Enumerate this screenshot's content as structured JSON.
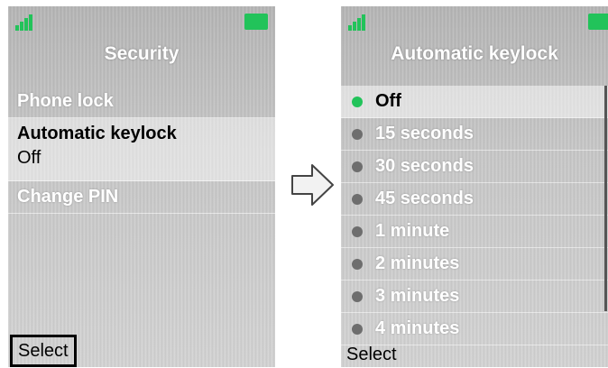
{
  "left_screen": {
    "title": "Security",
    "items": [
      {
        "label": "Phone lock"
      },
      {
        "label": "Automatic keylock",
        "value": "Off"
      },
      {
        "label": "Change PIN"
      }
    ],
    "softkey": "Select"
  },
  "right_screen": {
    "title": "Automatic keylock",
    "options": [
      {
        "label": "Off"
      },
      {
        "label": "15 seconds"
      },
      {
        "label": "30 seconds"
      },
      {
        "label": "45 seconds"
      },
      {
        "label": "1 minute"
      },
      {
        "label": "2 minutes"
      },
      {
        "label": "3 minutes"
      },
      {
        "label": "4 minutes"
      }
    ],
    "selected_option": "Off",
    "softkey": "Select"
  },
  "colors": {
    "accent_green": "#22c35a",
    "text_white": "#ffffff"
  },
  "icons": [
    "signal-icon",
    "battery-icon",
    "right-arrow-icon",
    "radio-icon"
  ]
}
